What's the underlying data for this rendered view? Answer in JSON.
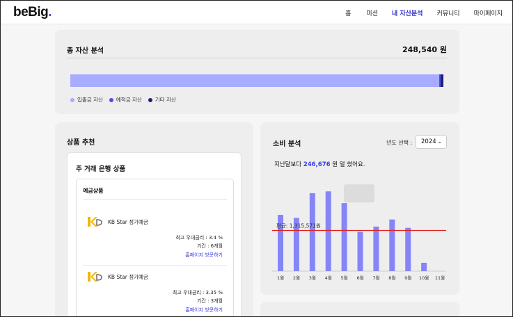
{
  "header": {
    "logo_text": "beBig",
    "logo_dot": ".",
    "nav": [
      "홈",
      "미션",
      "내 자산분석",
      "커뮤니티",
      "마이페이지"
    ],
    "active_nav": "내 자산분석",
    "accent_color": "#2f2fd0"
  },
  "asset": {
    "title": "총 자산 분석",
    "total": "248,540 원",
    "legend": [
      {
        "label": "입출금 자산",
        "color": "#a8acff"
      },
      {
        "label": "예적금 자산",
        "color": "#4a4de8"
      },
      {
        "label": "기타 자산",
        "color": "#1f2070"
      }
    ]
  },
  "recommend": {
    "title": "상품 추천",
    "bank_title": "주 거래 은행 상품",
    "deposit_title": "예금상품",
    "products": [
      {
        "name": "KB Star 정기예금",
        "rate": "최고 우대금리 : 3.4 %",
        "term": "기간 : 6개월",
        "link": "홈페이지 방문하기",
        "logo": "kb-logo-icon"
      },
      {
        "name": "KB Star 정기예금",
        "rate": "최고 우대금리 : 3.35 %",
        "term": "기간 : 3개월",
        "link": "홈페이지 방문하기",
        "logo": "kb-logo-icon"
      }
    ]
  },
  "spending": {
    "title": "소비 분석",
    "year_label": "년도 선택 :",
    "year_value": "2024",
    "summary_prefix": "지난달보다",
    "summary_amount": "246,676",
    "summary_suffix": "원 덜 썼어요.",
    "average_label": "평균: 1,315,571원",
    "bar_color": "#8585f8",
    "average_line_color": "#e02020"
  },
  "chart_data": {
    "type": "bar",
    "categories": [
      "1월",
      "2월",
      "3월",
      "4월",
      "5월",
      "6월",
      "7월",
      "8월",
      "9월",
      "10월",
      "11월"
    ],
    "values": [
      1820000,
      1720000,
      2520000,
      2580000,
      2200000,
      1270000,
      1440000,
      1670000,
      1400000,
      270000,
      0
    ],
    "average": 1315571,
    "ylim": [
      0,
      2900000
    ],
    "grid": false
  }
}
